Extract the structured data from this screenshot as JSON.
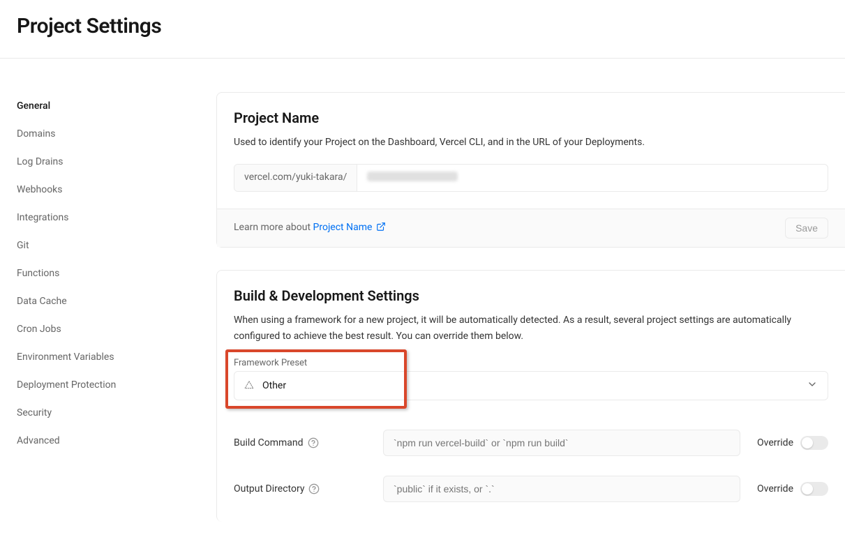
{
  "header": {
    "title": "Project Settings"
  },
  "sidebar": {
    "items": [
      {
        "label": "General",
        "active": true
      },
      {
        "label": "Domains",
        "active": false
      },
      {
        "label": "Log Drains",
        "active": false
      },
      {
        "label": "Webhooks",
        "active": false
      },
      {
        "label": "Integrations",
        "active": false
      },
      {
        "label": "Git",
        "active": false
      },
      {
        "label": "Functions",
        "active": false
      },
      {
        "label": "Data Cache",
        "active": false
      },
      {
        "label": "Cron Jobs",
        "active": false
      },
      {
        "label": "Environment Variables",
        "active": false
      },
      {
        "label": "Deployment Protection",
        "active": false
      },
      {
        "label": "Security",
        "active": false
      },
      {
        "label": "Advanced",
        "active": false
      }
    ]
  },
  "project_name_card": {
    "title": "Project Name",
    "description": "Used to identify your Project on the Dashboard, Vercel CLI, and in the URL of your Deployments.",
    "prefix": "vercel.com/yuki-takara/",
    "value_redacted": true,
    "footer_text": "Learn more about ",
    "footer_link_label": "Project Name",
    "save_label": "Save"
  },
  "build_card": {
    "title": "Build & Development Settings",
    "description": "When using a framework for a new project, it will be automatically detected. As a result, several project settings are automatically configured to achieve the best result. You can override them below.",
    "framework_label": "Framework Preset",
    "framework_value": "Other",
    "build_command_label": "Build Command",
    "build_command_placeholder": "`npm run vercel-build` or `npm run build`",
    "output_directory_label": "Output Directory",
    "output_directory_placeholder": "`public` if it exists, or `.`",
    "override_label": "Override"
  }
}
